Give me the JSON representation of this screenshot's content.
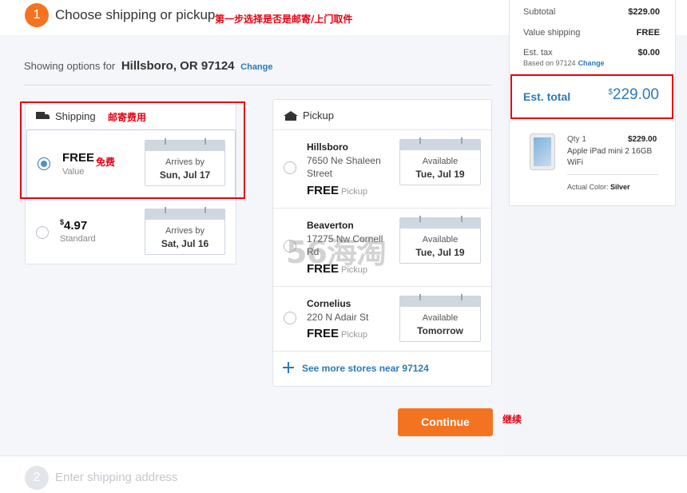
{
  "step1": {
    "number": "1",
    "title": "Choose shipping or pickup",
    "annotation": "第一步选择是否是邮寄/上门取件"
  },
  "location": {
    "prefix": "Showing options for",
    "value": "Hillsboro, OR 97124",
    "change_label": "Change"
  },
  "shipping": {
    "title": "Shipping",
    "annotation": "邮寄费用",
    "options": [
      {
        "price": "FREE",
        "speed": "Value",
        "arrive_label": "Arrives by",
        "arrive_date": "Sun, Jul 17",
        "selected": true,
        "annotation": "免费"
      },
      {
        "price_currency": "$",
        "price": "4.97",
        "speed": "Standard",
        "arrive_label": "Arrives by",
        "arrive_date": "Sat, Jul 16",
        "selected": false
      }
    ]
  },
  "pickup": {
    "title": "Pickup",
    "stores": [
      {
        "name": "Hillsboro",
        "address": "7650 Ne Shaleen Street",
        "price": "FREE",
        "price_label": "Pickup",
        "avail_label": "Available",
        "avail_date": "Tue, Jul 19"
      },
      {
        "name": "Beaverton",
        "address": "17275 Nw Cornell Rd",
        "price": "FREE",
        "price_label": "Pickup",
        "avail_label": "Available",
        "avail_date": "Tue, Jul 19"
      },
      {
        "name": "Cornelius",
        "address": "220 N Adair St",
        "price": "FREE",
        "price_label": "Pickup",
        "avail_label": "Available",
        "avail_date": "Tomorrow"
      }
    ],
    "more_label": "See more stores near 97124"
  },
  "continue": {
    "label": "Continue",
    "annotation": "继续"
  },
  "step2": {
    "number": "2",
    "title": "Enter shipping address"
  },
  "summary": {
    "subtotal_label": "Subtotal",
    "subtotal": "$229.00",
    "shipping_label": "Value shipping",
    "shipping": "FREE",
    "tax_label": "Est. tax",
    "tax": "$0.00",
    "tax_note": "Based on 97124",
    "tax_change": "Change",
    "total_label": "Est. total",
    "total_currency": "$",
    "total": "229.00",
    "item": {
      "qty": "Qty 1",
      "price": "$229.00",
      "name": "Apple iPad mini 2 16GB WiFi",
      "color_label": "Actual Color:",
      "color": "Silver"
    }
  },
  "watermark": "56海淘",
  "colors": {
    "accent": "#f47321",
    "link": "#2a7ab8",
    "annotation": "#e60012"
  }
}
